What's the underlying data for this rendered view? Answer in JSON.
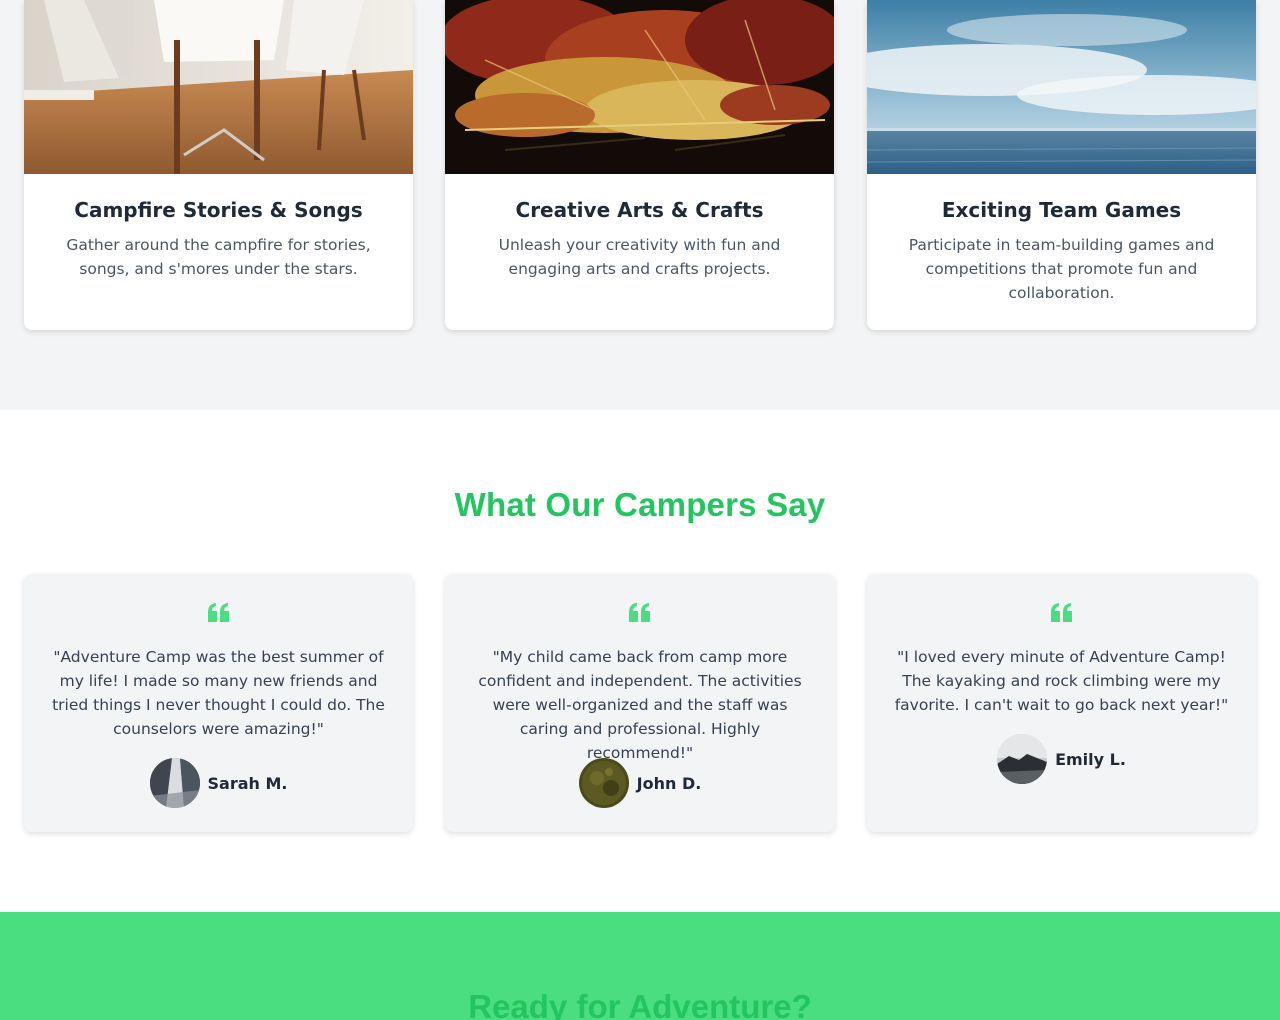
{
  "activities": [
    {
      "title": "Campfire Stories & Songs",
      "description": "Gather around the campfire for stories, songs, and s'mores under the stars.",
      "image": "dining-room-photo"
    },
    {
      "title": "Creative Arts & Crafts",
      "description": "Unleash your creativity with fun and engaging arts and crafts projects.",
      "image": "autumn-leaves-photo"
    },
    {
      "title": "Exciting Team Games",
      "description": "Participate in team-building games and competitions that promote fun and collaboration.",
      "image": "sea-sky-photo"
    }
  ],
  "testimonials": {
    "title": "What Our Campers Say",
    "quote_icon": "quote-icon",
    "items": [
      {
        "text": "\"Adventure Camp was the best summer of my life! I made so many new friends and tried things I never thought I could do. The counselors were amazing!\"",
        "author": "Sarah M."
      },
      {
        "text": "\"My child came back from camp more confident and independent. The activities were well-organized and the staff was caring and professional. Highly recommend!\"",
        "author": "John D."
      },
      {
        "text": "\"I loved every minute of Adventure Camp! The kayaking and rock climbing were my favorite. I can't wait to go back next year!\"",
        "author": "Emily L."
      }
    ]
  },
  "cta": {
    "title": "Ready for Adventure?"
  },
  "colors": {
    "accent": "#22c55e",
    "cta_background": "#4ade80",
    "section_background": "#f3f4f6"
  }
}
